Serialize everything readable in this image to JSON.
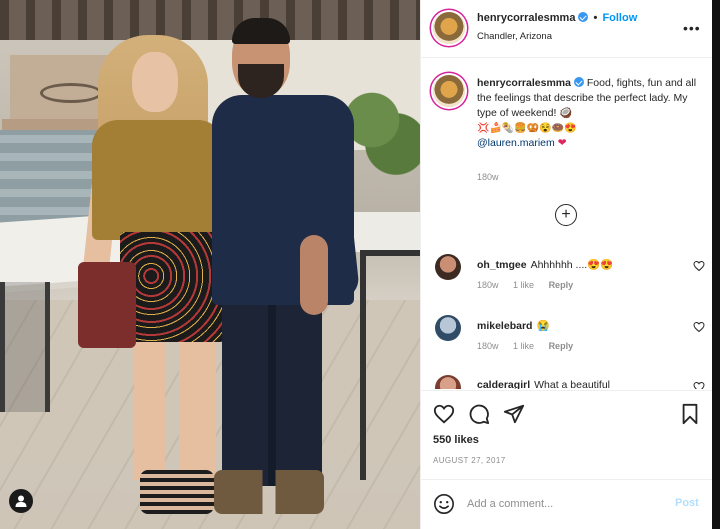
{
  "post": {
    "username": "henrycorralesmma",
    "follow_label": "Follow",
    "separator": "•",
    "location": "Chandler, Arizona",
    "more_label": "•••"
  },
  "caption": {
    "username": "henrycorralesmma",
    "text": "Food, fights, fun and all the feelings that describe the perfect lady. My type of weekend! 🥥",
    "emojis": "💢🍰🌯🍔🥨😵🍩😍",
    "mention": "@lauren.mariem",
    "heart": "❤",
    "time": "180w"
  },
  "load_more_label": "+",
  "comments": [
    {
      "username": "oh_tmgee",
      "text": "Ahhhhhh ....😍😍",
      "time": "180w",
      "likes": "1 like",
      "reply_label": "Reply"
    },
    {
      "username": "mikelebard",
      "text": "😭",
      "time": "180w",
      "likes": "1 like",
      "reply_label": "Reply"
    },
    {
      "username": "calderagirl",
      "text": "What a beautiful",
      "time": "",
      "likes": "",
      "reply_label": ""
    }
  ],
  "engagement": {
    "likes": "550 likes",
    "date": "AUGUST 27, 2017"
  },
  "add_comment": {
    "placeholder": "Add a comment...",
    "post_label": "Post"
  },
  "icons": {
    "verified": "verified-badge-icon",
    "heart": "heart-icon",
    "comment": "comment-icon",
    "share": "share-icon",
    "save": "bookmark-icon",
    "emoji": "smile-icon",
    "user_tag": "user-tag-icon"
  },
  "colors": {
    "accent": "#0095f6",
    "verified": "#3897f0",
    "muted": "#8e8e8e",
    "post_disabled": "#b2dffc"
  }
}
